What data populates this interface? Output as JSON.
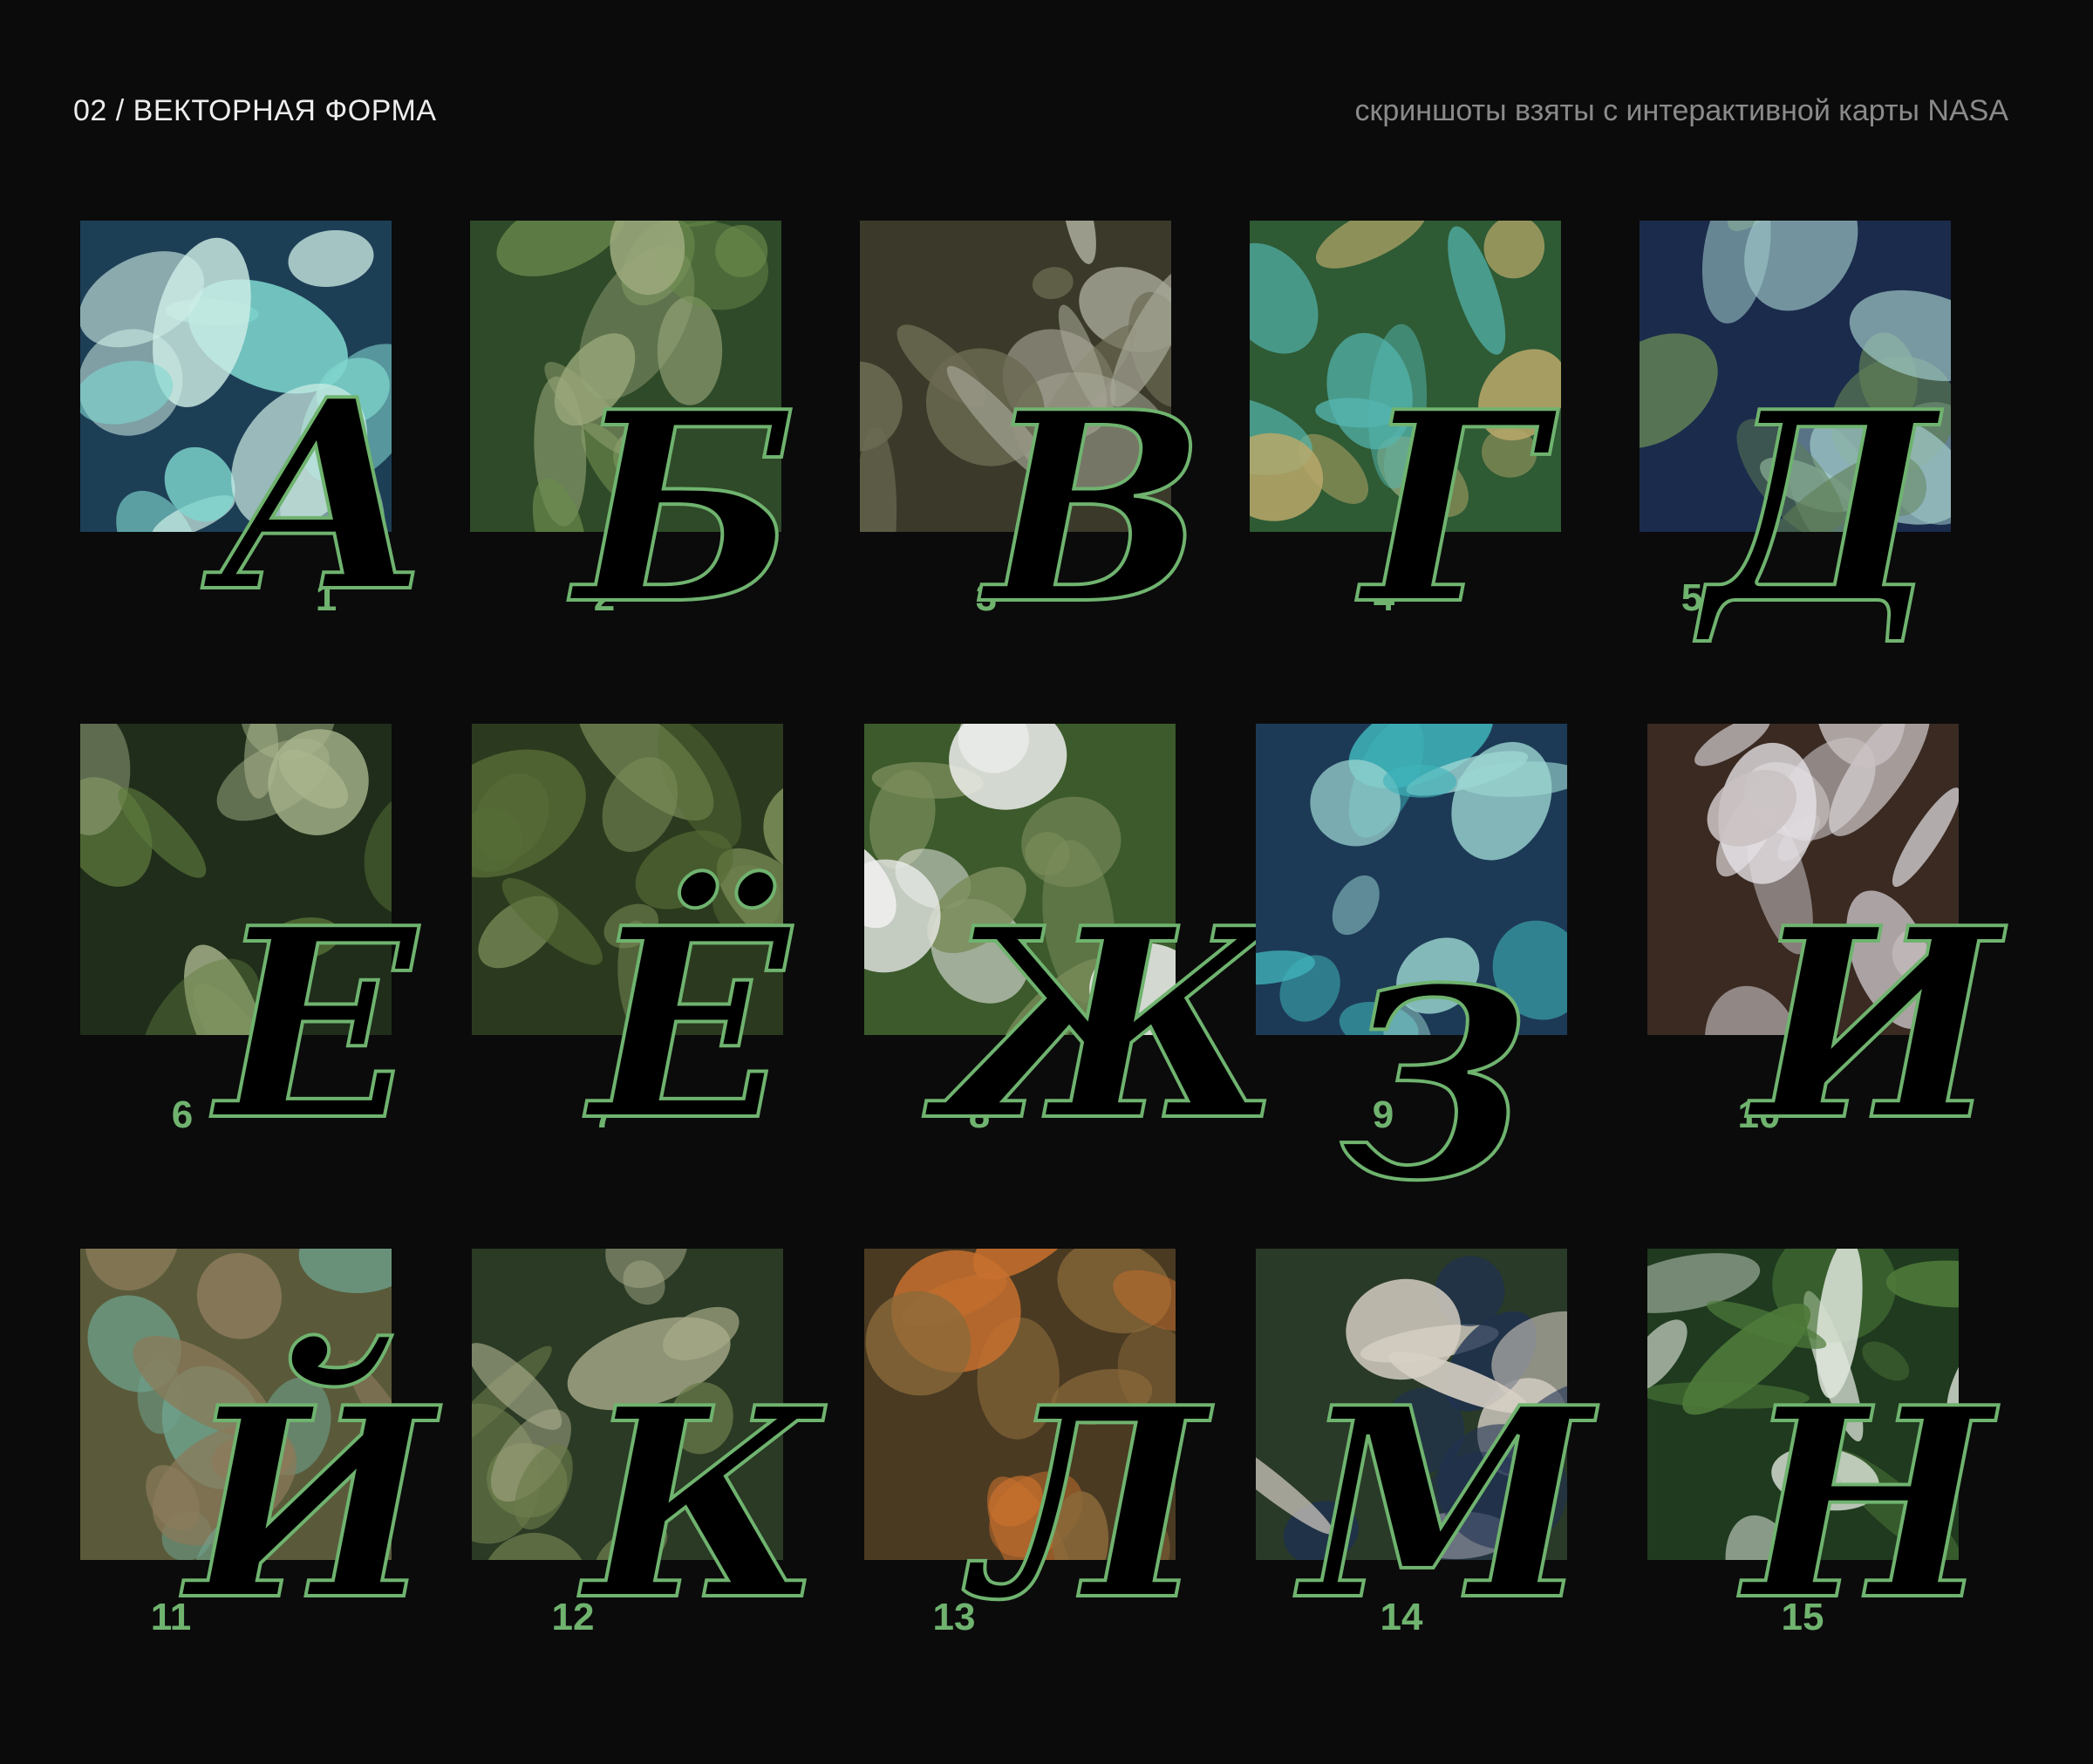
{
  "header": {
    "title": "02 / ВЕКТОРНАЯ ФОРМА",
    "source_note": "скриншоты взяты с интерактивной карты NASA"
  },
  "accent_color": "#6fb36f",
  "tiles": [
    {
      "number": "1",
      "letter": "А",
      "palette": [
        "#1d3f56",
        "#7fd6cf",
        "#cfeee6"
      ]
    },
    {
      "number": "2",
      "letter": "Б",
      "palette": [
        "#2f4a28",
        "#6a8a4c",
        "#9aa77a"
      ]
    },
    {
      "number": "3",
      "letter": "В",
      "palette": [
        "#3b3a2a",
        "#6b6a52",
        "#a8a898"
      ]
    },
    {
      "number": "4",
      "letter": "Г",
      "palette": [
        "#2e5a34",
        "#55b7b1",
        "#b8a86a"
      ]
    },
    {
      "number": "5",
      "letter": "Д",
      "palette": [
        "#1b2b4c",
        "#9fc8c8",
        "#5f7f54"
      ]
    },
    {
      "number": "6",
      "letter": "Е",
      "palette": [
        "#1f2d1a",
        "#5d7a3c",
        "#a9b58d"
      ]
    },
    {
      "number": "7",
      "letter": "Ё",
      "palette": [
        "#2b3a1e",
        "#566c36",
        "#7b8d58"
      ]
    },
    {
      "number": "8",
      "letter": "Ж",
      "palette": [
        "#3c5a2c",
        "#7a8c5a",
        "#f2f2f2"
      ]
    },
    {
      "number": "9",
      "letter": "З",
      "palette": [
        "#1c3a56",
        "#3fb3b9",
        "#9cd6d2"
      ]
    },
    {
      "number": "10",
      "letter": "И",
      "palette": [
        "#3a2a22",
        "#c9c2c2",
        "#e6e2e6"
      ]
    },
    {
      "number": "11",
      "letter": "Й",
      "palette": [
        "#5a5a3a",
        "#6fa38e",
        "#8a7a5a"
      ]
    },
    {
      "number": "12",
      "letter": "К",
      "palette": [
        "#2a3a24",
        "#6a7a4a",
        "#a8ab8a"
      ]
    },
    {
      "number": "13",
      "letter": "Л",
      "palette": [
        "#4a3a22",
        "#c8702e",
        "#8a6a3a"
      ]
    },
    {
      "number": "14",
      "letter": "М",
      "palette": [
        "#2a3a28",
        "#d6cfc4",
        "#1e3052"
      ]
    },
    {
      "number": "15",
      "letter": "Н",
      "palette": [
        "#1f3a1e",
        "#4e7a3a",
        "#dfe6dc"
      ]
    }
  ]
}
